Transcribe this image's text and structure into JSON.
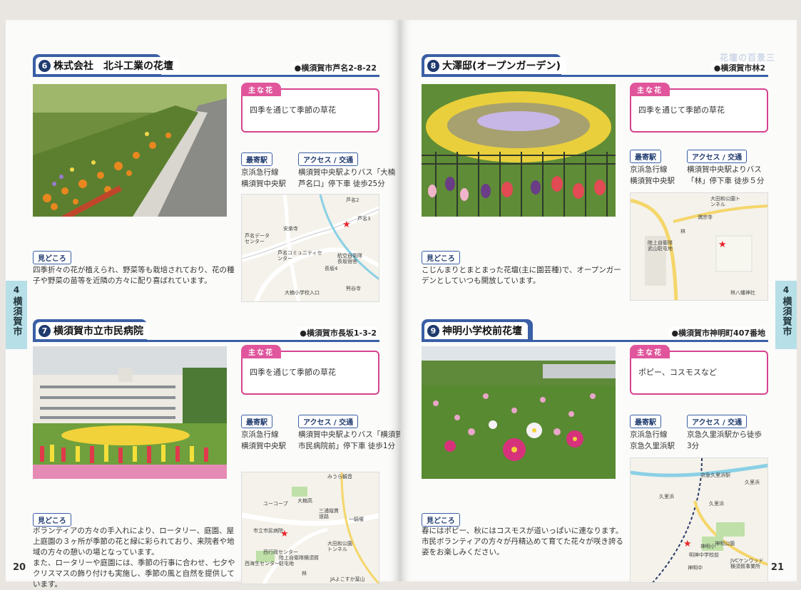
{
  "pages": {
    "left_number": "20",
    "right_number": "21",
    "side_tab_number": "4",
    "side_tab_text": "横須賀市",
    "corner_text": "花壇の百景三"
  },
  "labels": {
    "main_flower": "主な花",
    "nearest_station": "最寄駅",
    "access": "アクセス / 交通",
    "highlights": "見どころ"
  },
  "sections": [
    {
      "num": "6",
      "title": "株式会社　北斗工業の花壇",
      "address": "●横須賀市芦名2-8-22",
      "flowers": "四季を通じて季節の草花",
      "station_lines": [
        "京浜急行線",
        "横須賀中央駅"
      ],
      "access_lines": [
        "横須賀中央駅よりバス「大楠",
        "芦名口」停下車 徒歩25分"
      ],
      "map_labels": [
        "芦名2",
        "安楽寺",
        "芦名3",
        "芦名データセンター",
        "芦名コミュニティセンター",
        "航空自衛隊長坂宿舎",
        "長坂4",
        "大楠小学校入口",
        "熊谷寺"
      ],
      "description": "四季折々の花が植えられ、野菜等も栽培されており、花の種子や野菜の苗等を近隣の方々に配り喜ばれています。"
    },
    {
      "num": "7",
      "title": "横須賀市立市民病院",
      "address": "●横須賀市長坂1-3-2",
      "flowers": "四季を通じて季節の草花",
      "station_lines": [
        "京浜急行線",
        "横須賀中央駅"
      ],
      "access_lines": [
        "横須賀中央駅よりバス「横須賀",
        "市民病院前」停下車 徒歩1分"
      ],
      "map_labels": [
        "みうら観音",
        "ユーコープ",
        "大楠高",
        "三浦縦貫道路",
        "一騎塚",
        "市立市民病院",
        "大田和公園トンネル",
        "西行政センター",
        "陸上自衛隊横須賀駐屯地",
        "西海生センター",
        "林",
        "JAよこすか葉山"
      ],
      "description": "ボランティアの方々の手入れにより、ロータリー、庭園、屋上庭園の３ヶ所が季節の花と緑に彩られており、来院者や地域の方々の憩いの場となっています。\nまた、ロータリーや庭園には、季節の行事に合わせ、七夕やクリスマスの飾り付けも実施し、季節の風と自然を提供しています。"
    },
    {
      "num": "8",
      "title": "大澤邸(オープンガーデン)",
      "address": "●横須賀市林2",
      "flowers": "四季を通じて季節の草花",
      "station_lines": [
        "京浜急行線",
        "横須賀中央駅"
      ],
      "access_lines": [
        "横須賀中央駅よりバス",
        "「林」停下車 徒歩５分"
      ],
      "map_labels": [
        "大田和公園トンネル",
        "満宗寺",
        "林",
        "陸上自衛隊武山駐屯地",
        "林八幡神社"
      ],
      "description": "こじんまりとまとまった花壇(主に園芸種)で、オープンガーデンとしていつも開放しています。"
    },
    {
      "num": "9",
      "title": "神明小学校前花壇",
      "address": "●横須賀市神明町407番地",
      "flowers": "ポピー、コスモスなど",
      "station_lines": [
        "京浜急行線",
        "京急久里浜駅"
      ],
      "access_lines": [
        "京急久里浜駅から徒歩",
        "3分"
      ],
      "map_labels": [
        "京急久里浜駅",
        "久里浜",
        "久里浜",
        "久里浜",
        "神明小",
        "明神中学校前",
        "神明公園",
        "神明中",
        "JVCケンウッド横須賀事業所"
      ],
      "description": "春にはポピー、秋にはコスモスが道いっぱいに連なります。市民ボランティアの方々が丹精込めて育てた花々が咲き誇る姿をお楽しみください。"
    }
  ],
  "colors": {
    "header_blue": "#3a5fa6",
    "flower_pink": "#d6438f",
    "side_tab": "#b7dfe7",
    "map_star": "#e8262a"
  }
}
